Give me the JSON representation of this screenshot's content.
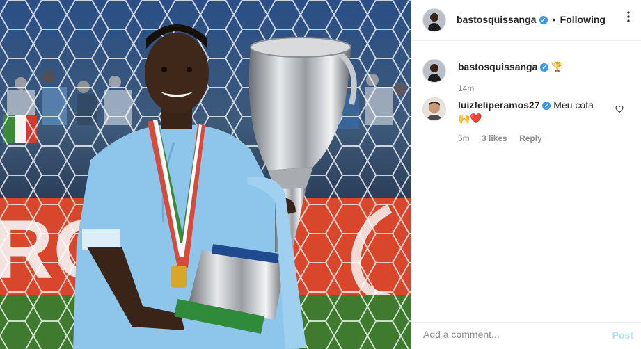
{
  "post": {
    "author": "bastosquissanga",
    "follow_separator": "•",
    "follow_status": "Following",
    "more_icon": "more-options-icon"
  },
  "caption": {
    "author": "bastosquissanga",
    "emoji": "🏆",
    "time": "14m"
  },
  "comment": {
    "author": "luizfeliperamos27",
    "text": "Meu cota",
    "emojis": "🙌❤️",
    "time": "5m",
    "likes": "3 likes",
    "reply_label": "Reply"
  },
  "composer": {
    "placeholder": "Add a comment...",
    "post_label": "Post"
  },
  "colors": {
    "verified": "#3897f0",
    "kit": "#8ec5ea",
    "pitch": "#3f7a2f",
    "ad_board": "#d8462b"
  }
}
